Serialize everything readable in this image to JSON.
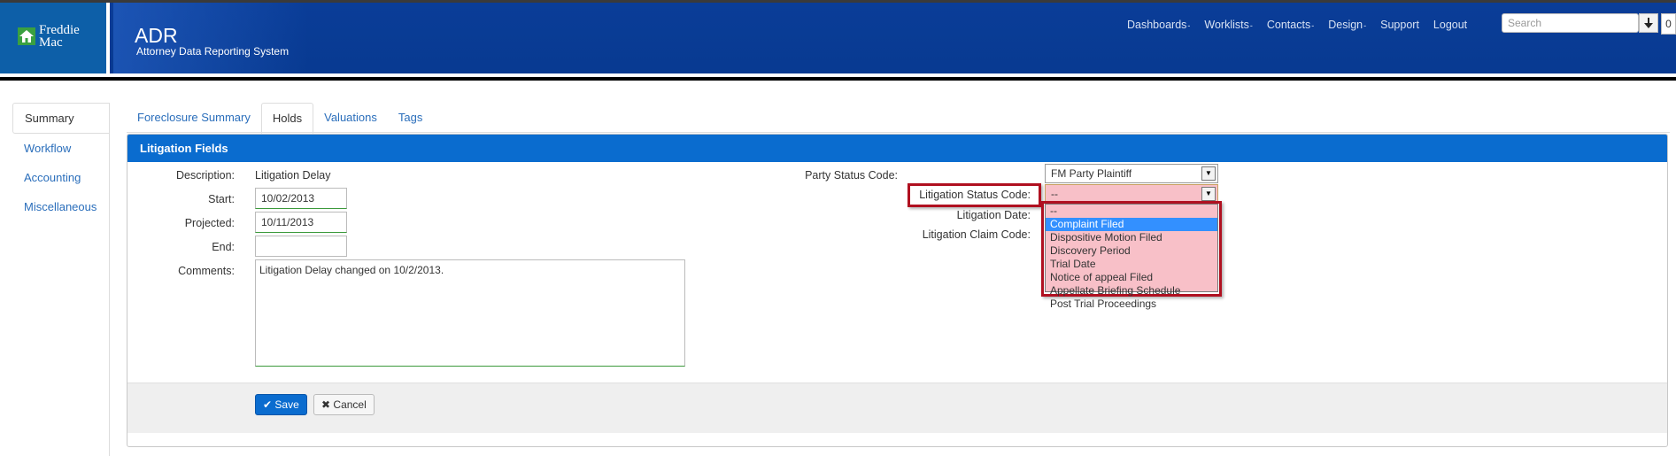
{
  "header": {
    "logo_line1": "Freddie",
    "logo_line2": "Mac",
    "app_title": "ADR",
    "app_subtitle": "Attorney Data Reporting System",
    "nav": [
      {
        "label": "Dashboards",
        "caret": "-"
      },
      {
        "label": "Worklists",
        "caret": "-"
      },
      {
        "label": "Contacts",
        "caret": "-"
      },
      {
        "label": "Design",
        "caret": "-"
      },
      {
        "label": "Support",
        "caret": ""
      },
      {
        "label": "Logout",
        "caret": ""
      }
    ],
    "search_placeholder": "Search",
    "search_button": "🡫",
    "counter": "0",
    "colors": {
      "header_bg": "#083a91",
      "logo_bg": "#0d5fa8"
    }
  },
  "sidebar": {
    "items": [
      "Summary",
      "Workflow",
      "Accounting",
      "Miscellaneous"
    ]
  },
  "tabs": [
    "Foreclosure Summary",
    "Holds",
    "Valuations",
    "Tags"
  ],
  "panel": {
    "title": "Litigation Fields",
    "description_label": "Description:",
    "description_value": "Litigation Delay",
    "start_label": "Start:",
    "start_value": "10/02/2013",
    "projected_label": "Projected:",
    "projected_value": "10/11/2013",
    "end_label": "End:",
    "end_value": "",
    "comments_label": "Comments:",
    "comments_value": "Litigation Delay changed on 10/2/2013.",
    "party_status_label": "Party Status Code:",
    "party_status_value": "FM Party Plaintiff",
    "litigation_status_label": "Litigation Status Code:",
    "litigation_status_value": "--",
    "litigation_date_label": "Litigation Date:",
    "litigation_claim_label": "Litigation Claim Code:",
    "litigation_status_options": [
      "--",
      "Complaint Filed",
      "Dispositive Motion Filed",
      "Discovery Period",
      "Trial Date",
      "Notice of appeal Filed",
      "Appellate Briefing Schedule",
      "Post Trial Proceedings"
    ],
    "highlighted_option": "Complaint Filed",
    "save_label": "Save",
    "cancel_label": "Cancel",
    "colors": {
      "panel_head": "#0a6ccf",
      "highlight": "#b01020",
      "dropdown_bg": "#f8c0c8"
    }
  }
}
